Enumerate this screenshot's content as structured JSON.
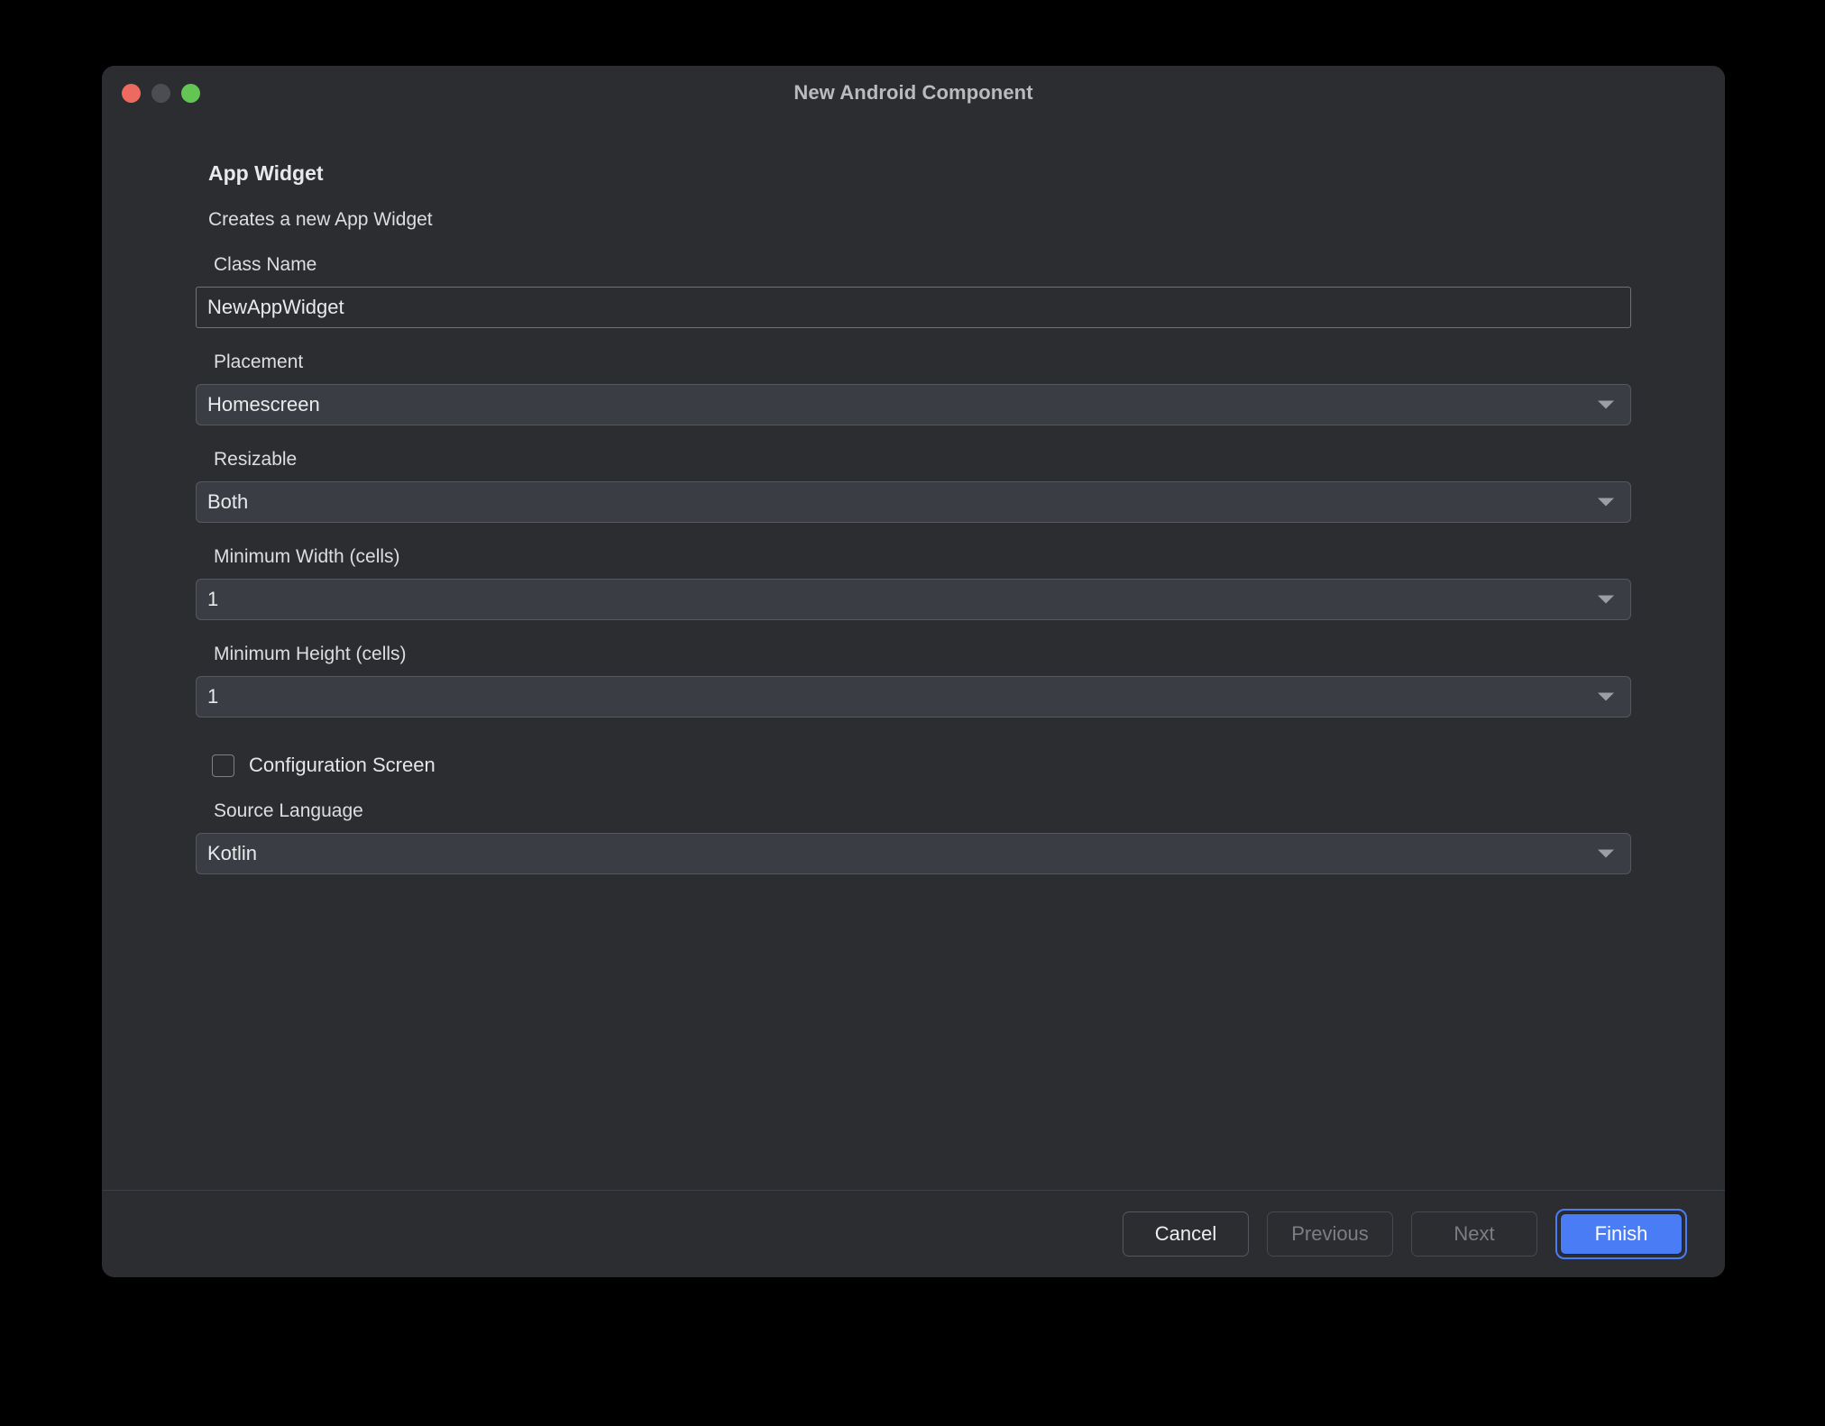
{
  "window": {
    "title": "New Android Component",
    "traffic_lights": [
      {
        "name": "close",
        "color": "#ec6a5f"
      },
      {
        "name": "minimize",
        "color": "#4b4d52"
      },
      {
        "name": "maximize",
        "color": "#62c554"
      }
    ]
  },
  "content": {
    "heading": "App Widget",
    "subtitle": "Creates a new App Widget",
    "fields": {
      "class_name": {
        "label": "Class Name",
        "value": "NewAppWidget"
      },
      "placement": {
        "label": "Placement",
        "value": "Homescreen"
      },
      "resizable": {
        "label": "Resizable",
        "value": "Both"
      },
      "min_width": {
        "label": "Minimum Width (cells)",
        "value": "1"
      },
      "min_height": {
        "label": "Minimum Height (cells)",
        "value": "1"
      },
      "configuration_screen": {
        "label": "Configuration Screen",
        "checked": false
      },
      "source_language": {
        "label": "Source Language",
        "value": "Kotlin"
      }
    }
  },
  "footer": {
    "cancel_label": "Cancel",
    "previous_label": "Previous",
    "next_label": "Next",
    "finish_label": "Finish",
    "accent_color": "#4a7df5"
  }
}
